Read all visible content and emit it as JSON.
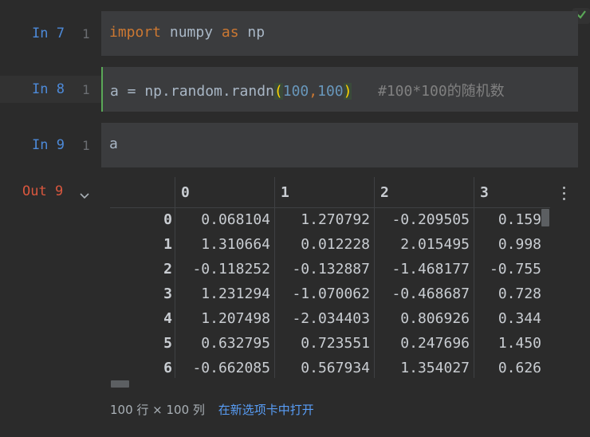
{
  "cells": [
    {
      "label": "In 7",
      "line": "1",
      "tokens": [
        "import",
        " numpy ",
        "as",
        " np"
      ]
    },
    {
      "label": "In 8",
      "line": "1",
      "code_left": "a = np.random.randn",
      "open": "(",
      "n1": "100",
      "comma": ",",
      "n2": "100",
      "close": ")",
      "comment": "#100*100",
      "comment_cjk": "的随机数"
    },
    {
      "label": "In 9",
      "line": "1",
      "code": "a"
    }
  ],
  "output": {
    "label": "Out 9",
    "columns": [
      "0",
      "1",
      "2",
      "3"
    ],
    "rows": [
      {
        "index": "0",
        "values": [
          "0.068104",
          "1.270792",
          "-0.209505",
          "0.159"
        ]
      },
      {
        "index": "1",
        "values": [
          "1.310664",
          "0.012228",
          "2.015495",
          "0.998"
        ]
      },
      {
        "index": "2",
        "values": [
          "-0.118252",
          "-0.132887",
          "-1.468177",
          "-0.755"
        ]
      },
      {
        "index": "3",
        "values": [
          "1.231294",
          "-1.070062",
          "-0.468687",
          "0.728"
        ]
      },
      {
        "index": "4",
        "values": [
          "1.207498",
          "-2.034403",
          "0.806926",
          "0.344"
        ]
      },
      {
        "index": "5",
        "values": [
          "0.632795",
          "0.723551",
          "0.247696",
          "1.450"
        ]
      },
      {
        "index": "6",
        "values": [
          "-0.662085",
          "0.567934",
          "1.354027",
          "0.626"
        ]
      }
    ],
    "shape_text": "100 行 × 100 列",
    "open_link": "在新选项卡中打开"
  },
  "colors": {
    "in": "#4d8ad9",
    "out": "#d9573e",
    "keyword": "#cc7832",
    "number": "#6897bb",
    "link": "#589df6",
    "check": "#5aa857"
  },
  "icons": [
    "check-icon",
    "chevron-down-icon",
    "more-vertical-icon"
  ]
}
